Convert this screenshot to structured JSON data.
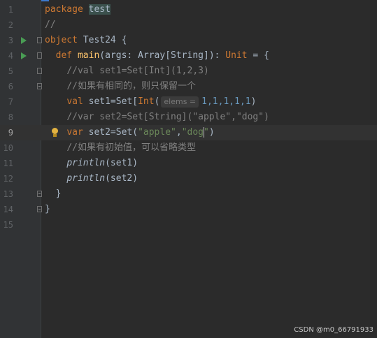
{
  "editor": {
    "lines": [
      {
        "num": "1"
      },
      {
        "num": "2"
      },
      {
        "num": "3"
      },
      {
        "num": "4"
      },
      {
        "num": "5"
      },
      {
        "num": "6"
      },
      {
        "num": "7"
      },
      {
        "num": "8"
      },
      {
        "num": "9"
      },
      {
        "num": "10"
      },
      {
        "num": "11"
      },
      {
        "num": "12"
      },
      {
        "num": "13"
      },
      {
        "num": "14"
      },
      {
        "num": "15"
      }
    ],
    "code": {
      "l1": {
        "kw": "package",
        "pkg": "test"
      },
      "l2": {
        "comment": "//"
      },
      "l3": {
        "kw": "object",
        "name": " Test24 {"
      },
      "l4": {
        "kw": "def",
        "fn": "main",
        "params": "(args: Array[String]): ",
        "ret": "Unit",
        "tail": " = {"
      },
      "l5": {
        "comment": "//val set1=Set[Int](1,2,3)"
      },
      "l6": {
        "comment": "//如果有相同的，则只保留一个"
      },
      "l7": {
        "kw": "val",
        "decl": " set1=Set[",
        "type": "Int",
        "open": "(",
        "hint": "elems =",
        "nums": "1,1,1,1,1",
        "close": ")"
      },
      "l8": {
        "comment": "//var set2=Set[String](\"apple\",\"dog\")"
      },
      "l9": {
        "kw": "var",
        "decl": " set2=Set(",
        "s1": "\"apple\"",
        "comma": ",",
        "s2a": "\"dog",
        "s2b": "\"",
        "close": ")"
      },
      "l10": {
        "comment": "//如果有初始值，可以省略类型"
      },
      "l11": {
        "fn": "println",
        "args": "(set1)"
      },
      "l12": {
        "fn": "println",
        "args": "(set2)"
      },
      "l13": {
        "brace": "}"
      },
      "l14": {
        "brace": "}"
      }
    }
  },
  "watermark": "CSDN @m0_66791933",
  "colors": {
    "background": "#2b2b2b",
    "keyword": "#cc7832",
    "comment": "#808080",
    "string": "#6a8759",
    "number": "#6897bb",
    "function": "#ffc66d"
  }
}
